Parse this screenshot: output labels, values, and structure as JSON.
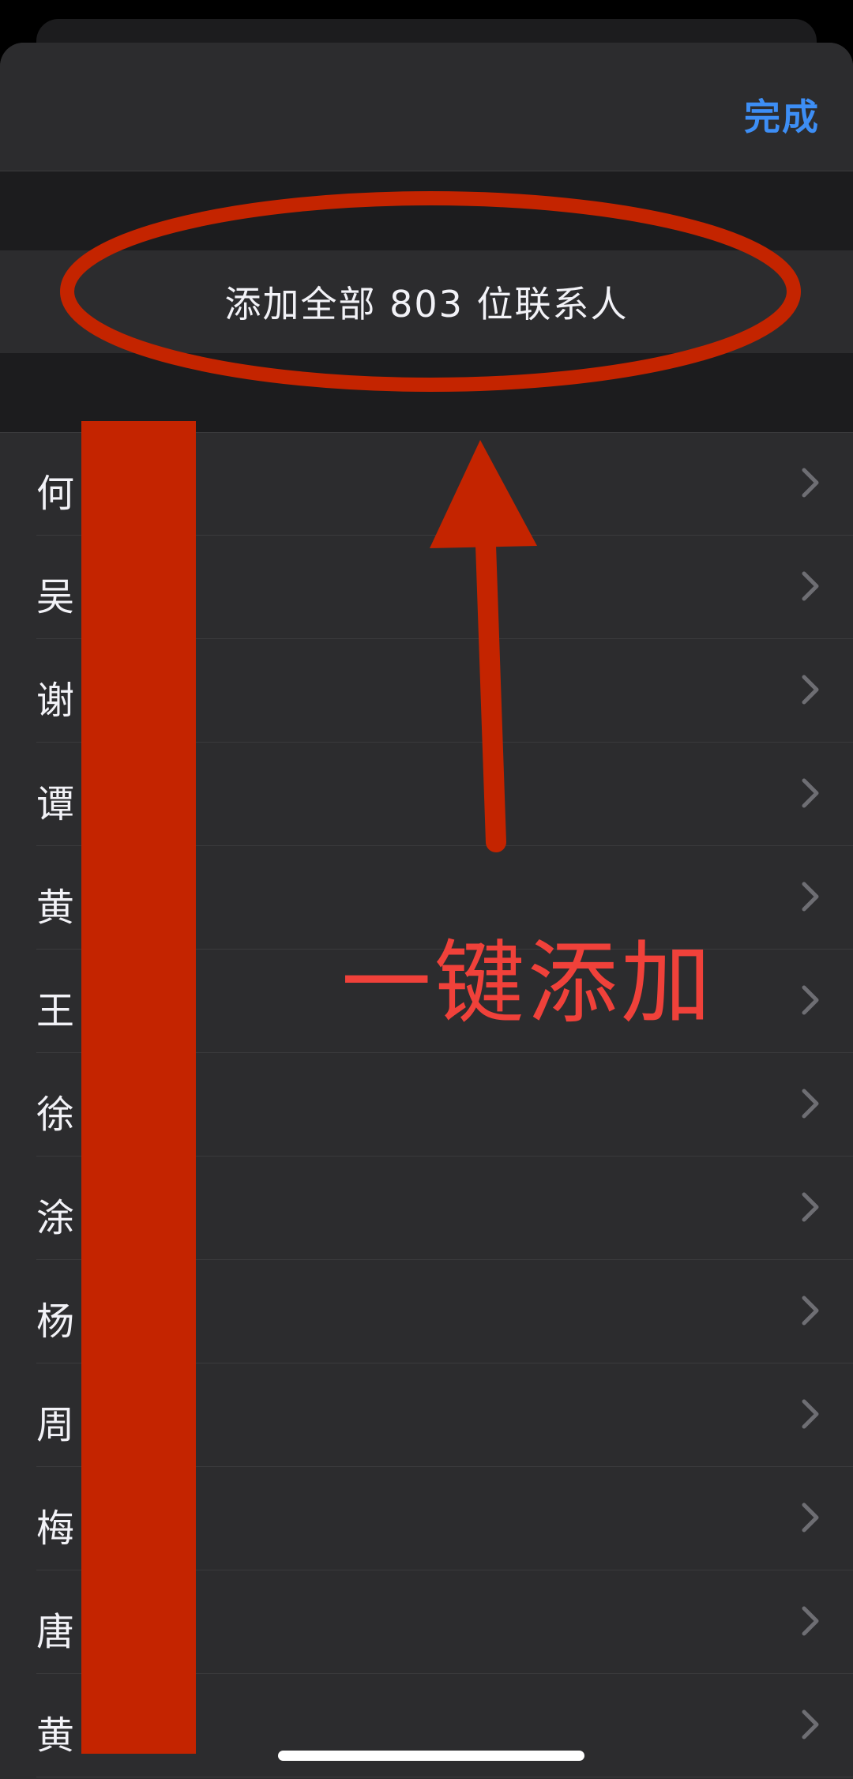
{
  "navbar": {
    "done_label": "完成"
  },
  "add_all": {
    "label": "添加全部 803 位联系人"
  },
  "contacts": [
    {
      "name": "何"
    },
    {
      "name": "吴"
    },
    {
      "name": "谢"
    },
    {
      "name": "谭"
    },
    {
      "name": "黄"
    },
    {
      "name": "王"
    },
    {
      "name": "徐"
    },
    {
      "name": "涂"
    },
    {
      "name": "杨"
    },
    {
      "name": "周"
    },
    {
      "name": "梅"
    },
    {
      "name": "唐"
    },
    {
      "name": "黄"
    }
  ],
  "annotation": {
    "caption": "一键添加",
    "color": "#c42400",
    "caption_color": "#f0413a"
  },
  "icons": {
    "row_chevron": "chevron-right-icon"
  },
  "colors": {
    "accent": "#3d8ef5",
    "sheet_background": "#2c2c2e",
    "separator_band": "#1c1c1e",
    "text": "#f2f2f7"
  }
}
